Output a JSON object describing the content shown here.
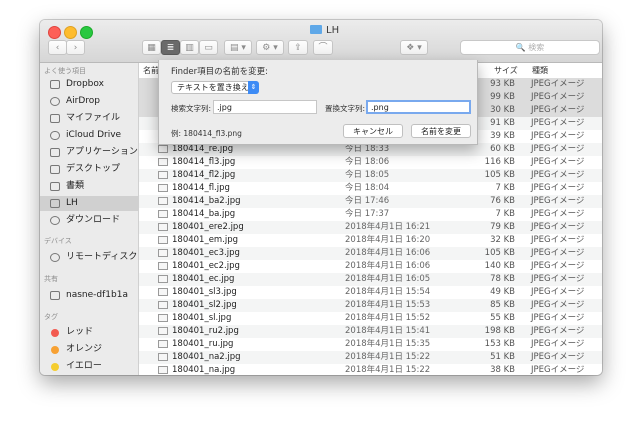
{
  "window": {
    "title": "LH"
  },
  "toolbar": {
    "back": "‹",
    "forward": "›",
    "view_icons": "▦",
    "view_list": "≣",
    "view_columns": "▥",
    "view_gallery": "▭",
    "arrange": "▤ ▾",
    "action": "⚙ ▾",
    "share": "⇪",
    "tag": "⌒",
    "dropbox": "❖ ▾",
    "search_placeholder": "🔍 検索"
  },
  "sidebar": {
    "favorites_header": "よく使う項目",
    "favorites": [
      {
        "label": "Dropbox",
        "icon": "dropbox-icon"
      },
      {
        "label": "AirDrop",
        "icon": "airdrop-icon"
      },
      {
        "label": "マイファイル",
        "icon": "files-icon"
      },
      {
        "label": "iCloud Drive",
        "icon": "cloud-icon"
      },
      {
        "label": "アプリケーション",
        "icon": "applications-icon"
      },
      {
        "label": "デスクトップ",
        "icon": "desktop-icon"
      },
      {
        "label": "書類",
        "icon": "documents-icon"
      },
      {
        "label": "LH",
        "icon": "folder-icon"
      },
      {
        "label": "ダウンロード",
        "icon": "downloads-icon"
      }
    ],
    "devices_header": "デバイス",
    "devices": [
      {
        "label": "リモートディスク",
        "icon": "remote-disk-icon"
      }
    ],
    "shared_header": "共有",
    "shared": [
      {
        "label": "nasne-df1b1a",
        "icon": "server-icon"
      }
    ],
    "tags_header": "タグ",
    "tags": [
      {
        "label": "レッド",
        "color": "#f25a50"
      },
      {
        "label": "オレンジ",
        "color": "#f7a133"
      },
      {
        "label": "イエロー",
        "color": "#f5cd2f"
      }
    ]
  },
  "columns": {
    "name": "名前",
    "size": "サイズ",
    "kind": "種類"
  },
  "files": [
    {
      "name": "",
      "date": "",
      "size": "93 KB",
      "kind": "JPEGイメージ"
    },
    {
      "name": "",
      "date": "",
      "size": "99 KB",
      "kind": "JPEGイメージ"
    },
    {
      "name": "",
      "date": "",
      "size": "30 KB",
      "kind": "JPEGイメージ"
    },
    {
      "name": "",
      "date": "",
      "size": "91 KB",
      "kind": "JPEGイメージ"
    },
    {
      "name": "",
      "date": "",
      "size": "39 KB",
      "kind": "JPEGイメージ"
    },
    {
      "name": "180414_re.jpg",
      "date": "今日 18:33",
      "size": "60 KB",
      "kind": "JPEGイメージ"
    },
    {
      "name": "180414_fl3.jpg",
      "date": "今日 18:06",
      "size": "116 KB",
      "kind": "JPEGイメージ"
    },
    {
      "name": "180414_fl2.jpg",
      "date": "今日 18:05",
      "size": "105 KB",
      "kind": "JPEGイメージ"
    },
    {
      "name": "180414_fl.jpg",
      "date": "今日 18:04",
      "size": "7 KB",
      "kind": "JPEGイメージ"
    },
    {
      "name": "180414_ba2.jpg",
      "date": "今日 17:46",
      "size": "76 KB",
      "kind": "JPEGイメージ"
    },
    {
      "name": "180414_ba.jpg",
      "date": "今日 17:37",
      "size": "7 KB",
      "kind": "JPEGイメージ"
    },
    {
      "name": "180401_ere2.jpg",
      "date": "2018年4月1日 16:21",
      "size": "79 KB",
      "kind": "JPEGイメージ"
    },
    {
      "name": "180401_em.jpg",
      "date": "2018年4月1日 16:20",
      "size": "32 KB",
      "kind": "JPEGイメージ"
    },
    {
      "name": "180401_ec3.jpg",
      "date": "2018年4月1日 16:06",
      "size": "105 KB",
      "kind": "JPEGイメージ"
    },
    {
      "name": "180401_ec2.jpg",
      "date": "2018年4月1日 16:06",
      "size": "140 KB",
      "kind": "JPEGイメージ"
    },
    {
      "name": "180401_ec.jpg",
      "date": "2018年4月1日 16:05",
      "size": "78 KB",
      "kind": "JPEGイメージ"
    },
    {
      "name": "180401_sl3.jpg",
      "date": "2018年4月1日 15:54",
      "size": "49 KB",
      "kind": "JPEGイメージ"
    },
    {
      "name": "180401_sl2.jpg",
      "date": "2018年4月1日 15:53",
      "size": "85 KB",
      "kind": "JPEGイメージ"
    },
    {
      "name": "180401_sl.jpg",
      "date": "2018年4月1日 15:52",
      "size": "55 KB",
      "kind": "JPEGイメージ"
    },
    {
      "name": "180401_ru2.jpg",
      "date": "2018年4月1日 15:41",
      "size": "198 KB",
      "kind": "JPEGイメージ"
    },
    {
      "name": "180401_ru.jpg",
      "date": "2018年4月1日 15:35",
      "size": "153 KB",
      "kind": "JPEGイメージ"
    },
    {
      "name": "180401_na2.jpg",
      "date": "2018年4月1日 15:22",
      "size": "51 KB",
      "kind": "JPEGイメージ"
    },
    {
      "name": "180401_na.jpg",
      "date": "2018年4月1日 15:22",
      "size": "38 KB",
      "kind": "JPEGイメージ"
    }
  ],
  "rename_sheet": {
    "title": "Finder項目の名前を変更:",
    "mode": "テキストを置き換える",
    "find_label": "検索文字列:",
    "find_value": ".jpg",
    "replace_label": "置換文字列:",
    "replace_value": ".png",
    "example": "例: 180414_fl3.png",
    "cancel": "キャンセル",
    "rename": "名前を変更"
  }
}
